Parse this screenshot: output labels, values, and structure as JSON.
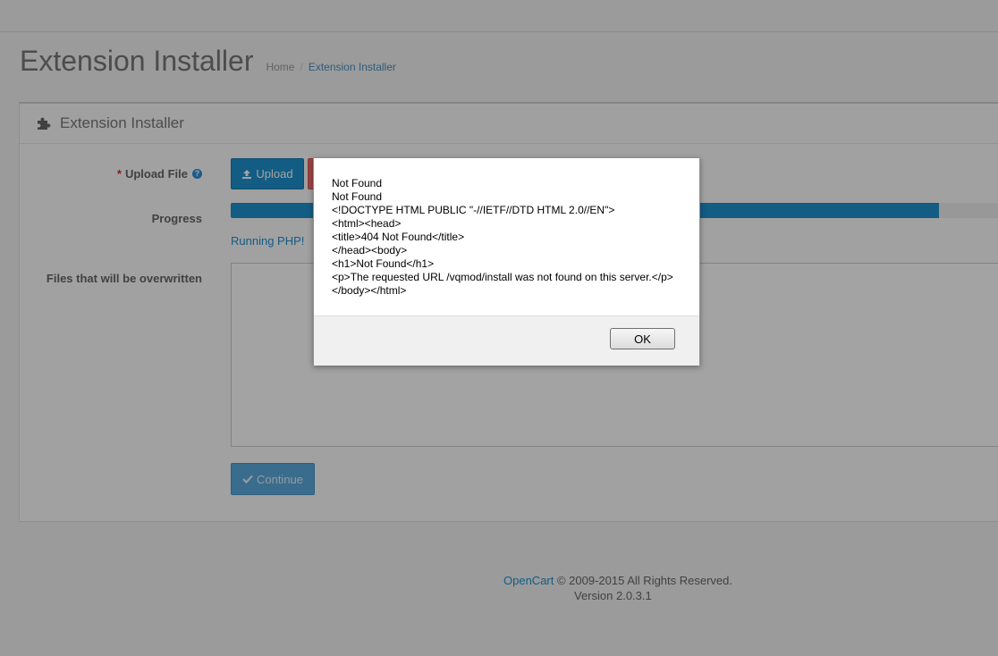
{
  "header": {
    "title": "Extension Installer",
    "breadcrumb": {
      "home": "Home",
      "separator": "/",
      "current": "Extension Installer"
    }
  },
  "panel": {
    "title": "Extension Installer",
    "upload_label": "Upload File",
    "upload_required": "*",
    "help_glyph": "?",
    "upload_button": "Upload",
    "progress_label": "Progress",
    "progress_fraction": 0.9,
    "progress_text": "Running PHP!",
    "overwrite_label": "Files that will be overwritten",
    "continue_button": "Continue"
  },
  "footer": {
    "brand": "OpenCart",
    "copyright": " © 2009-2015 All Rights Reserved.",
    "version": "Version 2.0.3.1"
  },
  "dialog": {
    "message": "Not Found\nNot Found\n<!DOCTYPE HTML PUBLIC \"-//IETF//DTD HTML 2.0//EN\">\n<html><head>\n<title>404 Not Found</title>\n</head><body>\n<h1>Not Found</h1>\n<p>The requested URL /vqmod/install was not found on this server.</p>\n</body></html>",
    "ok_button": "OK"
  },
  "icons": {
    "panel_heading": "puzzle-icon",
    "upload": "upload-icon",
    "continue": "check-icon",
    "help": "question-circle-icon"
  },
  "colors": {
    "primary": "#1e91cf",
    "danger": "#f56b6b",
    "required": "#e03030"
  }
}
